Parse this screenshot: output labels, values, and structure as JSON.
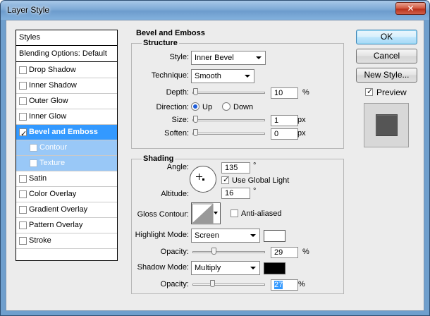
{
  "window": {
    "title": "Layer Style",
    "close_label": "✕"
  },
  "styles_panel": {
    "header": "Styles",
    "blending": "Blending Options: Default",
    "items": [
      {
        "label": "Drop Shadow",
        "checked": false
      },
      {
        "label": "Inner Shadow",
        "checked": false
      },
      {
        "label": "Outer Glow",
        "checked": false
      },
      {
        "label": "Inner Glow",
        "checked": false
      },
      {
        "label": "Bevel and Emboss",
        "checked": true,
        "selected": true
      },
      {
        "label": "Contour",
        "checked": false,
        "sub": true
      },
      {
        "label": "Texture",
        "checked": false,
        "sub": true
      },
      {
        "label": "Satin",
        "checked": false
      },
      {
        "label": "Color Overlay",
        "checked": false
      },
      {
        "label": "Gradient Overlay",
        "checked": false
      },
      {
        "label": "Pattern Overlay",
        "checked": false
      },
      {
        "label": "Stroke",
        "checked": false
      }
    ]
  },
  "bevel": {
    "title": "Bevel and Emboss",
    "structure": {
      "title": "Structure",
      "style_label": "Style:",
      "style_value": "Inner Bevel",
      "technique_label": "Technique:",
      "technique_value": "Smooth",
      "depth_label": "Depth:",
      "depth_value": "10",
      "depth_unit": "%",
      "direction_label": "Direction:",
      "direction_up": "Up",
      "direction_down": "Down",
      "direction_selected": "Up",
      "size_label": "Size:",
      "size_value": "1",
      "size_unit": "px",
      "soften_label": "Soften:",
      "soften_value": "0",
      "soften_unit": "px"
    },
    "shading": {
      "title": "Shading",
      "angle_label": "Angle:",
      "angle_value": "135",
      "angle_unit": "°",
      "global_light_label": "Use Global Light",
      "global_light_checked": true,
      "altitude_label": "Altitude:",
      "altitude_value": "16",
      "altitude_unit": "°",
      "gloss_label": "Gloss Contour:",
      "anti_aliased_label": "Anti-aliased",
      "anti_aliased_checked": false,
      "highlight_mode_label": "Highlight Mode:",
      "highlight_mode_value": "Screen",
      "highlight_color": "#ffffff",
      "highlight_opacity_label": "Opacity:",
      "highlight_opacity_value": "29",
      "highlight_opacity_unit": "%",
      "shadow_mode_label": "Shadow Mode:",
      "shadow_mode_value": "Multiply",
      "shadow_color": "#000000",
      "shadow_opacity_label": "Opacity:",
      "shadow_opacity_value": "27",
      "shadow_opacity_unit": "%"
    }
  },
  "buttons": {
    "ok": "OK",
    "cancel": "Cancel",
    "new_style": "New Style...",
    "preview_label": "Preview",
    "preview_checked": true
  }
}
